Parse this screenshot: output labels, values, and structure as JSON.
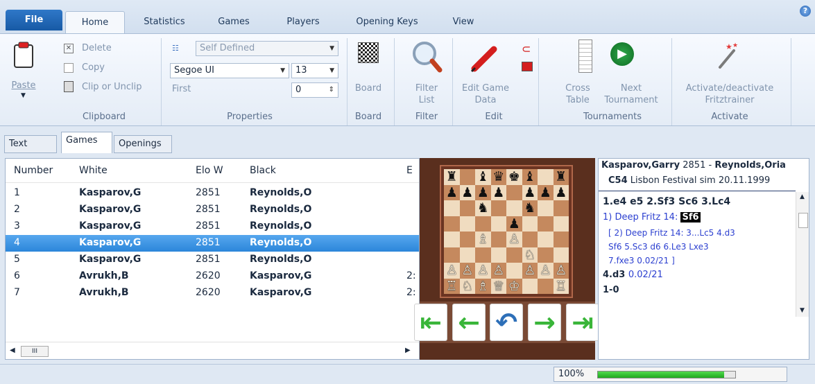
{
  "ribbon_tabs": [
    "File",
    "Home",
    "Statistics",
    "Games",
    "Players",
    "Opening Keys",
    "View"
  ],
  "clipboard": {
    "paste": "Paste",
    "delete": "Delete",
    "copy": "Copy",
    "clip": "Clip or Unclip",
    "group": "Clipboard"
  },
  "properties": {
    "style": "Self Defined",
    "font": "Segoe UI",
    "size": "13",
    "first_label": "First",
    "first_value": "0",
    "group": "Properties"
  },
  "board_group": {
    "button": "Board",
    "group": "Board"
  },
  "filter_group": {
    "button_line1": "Filter",
    "button_line2": "List",
    "group": "Filter"
  },
  "edit_group": {
    "button_line1": "Edit Game",
    "button_line2": "Data",
    "group": "Edit"
  },
  "tournaments_group": {
    "cross_line1": "Cross",
    "cross_line2": "Table",
    "next_line1": "Next",
    "next_line2": "Tournament",
    "group": "Tournaments"
  },
  "activate_group": {
    "button_line1": "Activate/deactivate",
    "button_line2": "Fritztrainer",
    "group": "Activate"
  },
  "sub_tabs": [
    "Text",
    "Games",
    "Openings"
  ],
  "games": {
    "columns": [
      "Number",
      "White",
      "Elo W",
      "Black",
      "E"
    ],
    "rows": [
      {
        "num": "1",
        "white": "Kasparov,G",
        "elo": "2851",
        "black": "Reynolds,O",
        "extra": ""
      },
      {
        "num": "2",
        "white": "Kasparov,G",
        "elo": "2851",
        "black": "Reynolds,O",
        "extra": ""
      },
      {
        "num": "3",
        "white": "Kasparov,G",
        "elo": "2851",
        "black": "Reynolds,O",
        "extra": ""
      },
      {
        "num": "4",
        "white": "Kasparov,G",
        "elo": "2851",
        "black": "Reynolds,O",
        "extra": ""
      },
      {
        "num": "5",
        "white": "Kasparov,G",
        "elo": "2851",
        "black": "Reynolds,O",
        "extra": ""
      },
      {
        "num": "6",
        "white": "Avrukh,B",
        "elo": "2620",
        "black": "Kasparov,G",
        "extra": "2:"
      },
      {
        "num": "7",
        "white": "Avrukh,B",
        "elo": "2620",
        "black": "Kasparov,G",
        "extra": "2:"
      }
    ],
    "scroll_thumb": "III"
  },
  "board_position": [
    "r.bqkb.r",
    "pppp.ppp",
    "..n..n..",
    "....p...",
    "..B.P...",
    ".....N..",
    "PPPP.PPP",
    "RNBQK..R"
  ],
  "notation": {
    "header_white": "Kasparov,Garry",
    "header_white_elo": "2851",
    "header_dash": " - ",
    "header_black": "Reynolds,Oria",
    "eco": "C54",
    "event": "Lisbon Festival sim 20.11.1999",
    "line1": "1.e4  e5  2.Sf3  Sc6  3.Lc4",
    "line2_prefix": "1) Deep Fritz 14: ",
    "line2_move": "Sf6",
    "line3": "[ 2) Deep Fritz 14: 3...Lc5  4.d3",
    "line4": "Sf6  5.Sc3  d6  6.Le3  Lxe3",
    "line5_move": "7.fxe3 ",
    "line5_eval": "0.02/21 ]",
    "line6_move": "4.d3 ",
    "line6_eval": "0.02/21",
    "result": "1-0"
  },
  "status": {
    "zoom": "100%",
    "zoom_fraction": 0.92
  }
}
